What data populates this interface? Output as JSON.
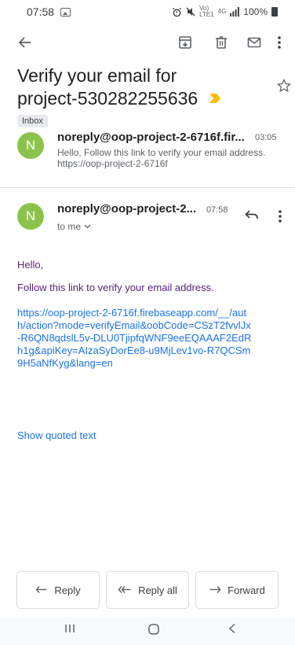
{
  "status_bar": {
    "time": "07:58",
    "network_top": "Vo)",
    "network_bottom": "LTE1",
    "signal_gen": "4G",
    "battery": "100%"
  },
  "toolbar": {
    "icons": [
      "back-arrow-icon",
      "archive-icon",
      "delete-icon",
      "mark-unread-icon",
      "more-vert-icon"
    ]
  },
  "subject": {
    "line1": "Verify your email for",
    "line2": "project-530282255636",
    "label": "Inbox"
  },
  "messages": {
    "collapsed": {
      "avatar_letter": "N",
      "sender": "noreply@oop-project-2-6716f.fir...",
      "time": "03:05",
      "snippet": "Hello, Follow this link to verify your email address. https://oop-project-2-6716f"
    },
    "expanded": {
      "avatar_letter": "N",
      "sender": "noreply@oop-project-2...",
      "time": "07:58",
      "recipient": "to me",
      "greeting": "Hello,",
      "instruction": "Follow this link to verify your email address.",
      "link": "https://oop-project-2-6716f.firebaseapp.com/__/auth/action?mode=verifyEmail&oobCode=CSzT2fvvlJx-R6QN8qdslL5v-DLU0TjipfqWNF9eeEQAAAF2EdRh1g&apiKey=AIzaSyDorEe8-u9MjLev1vo-R7QCSm9H5aNfKyg&lang=en",
      "show_quoted": "Show quoted text"
    }
  },
  "actions": {
    "reply": "Reply",
    "reply_all": "Reply all",
    "forward": "Forward"
  },
  "colors": {
    "avatar": "#8bc34a",
    "label_arrow": "#fbbc04",
    "link": "#1a73e8",
    "body_text": "#5b1f7a"
  }
}
